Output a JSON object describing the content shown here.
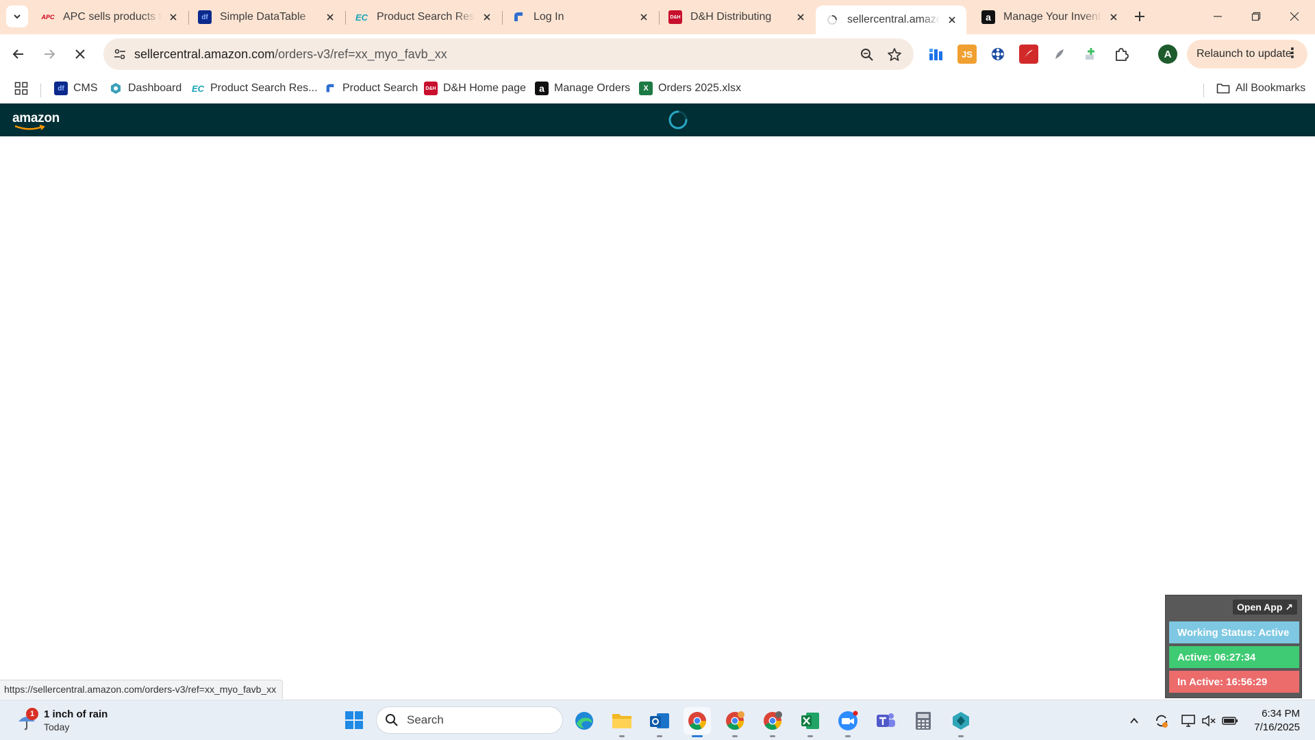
{
  "browser": {
    "tabs": [
      {
        "title": "APC sells products th",
        "favicon_text": "APC",
        "active": false
      },
      {
        "title": "Simple DataTable",
        "favicon_text": "df",
        "active": false
      },
      {
        "title": "Product Search Resul",
        "favicon_text": "EC",
        "active": false
      },
      {
        "title": "Log In",
        "favicon_text": "",
        "active": false
      },
      {
        "title": "D&H Distributing",
        "favicon_text": "D&H",
        "active": false
      },
      {
        "title": "sellercentral.amazon.",
        "favicon_text": "",
        "active": true
      },
      {
        "title": "Manage Your Invento",
        "favicon_text": "a",
        "active": false
      }
    ],
    "url_host": "sellercentral.amazon.com",
    "url_path": "/orders-v3/ref=xx_myo_favb_xx",
    "relaunch_label": "Relaunch to update",
    "profile_initial": "A",
    "bookmarks": [
      {
        "label": "CMS",
        "icon_text": "df"
      },
      {
        "label": "Dashboard",
        "icon_text": ""
      },
      {
        "label": "Product Search Res...",
        "icon_text": "EC"
      },
      {
        "label": "Product Search",
        "icon_text": ""
      },
      {
        "label": "D&H Home page",
        "icon_text": "D&H"
      },
      {
        "label": "Manage Orders",
        "icon_text": "a"
      },
      {
        "label": "Orders 2025.xlsx",
        "icon_text": "X"
      }
    ],
    "all_bookmarks_label": "All Bookmarks",
    "status_url": "https://sellercentral.amazon.com/orders-v3/ref=xx_myo_favb_xx"
  },
  "page": {
    "logo_text": "amazon",
    "loading": true
  },
  "widget": {
    "open_app_label": "Open App ↗",
    "working_status": "Working Status: Active",
    "active_time": "Active: 06:27:34",
    "inactive_time": "In Active: 16:56:29"
  },
  "taskbar": {
    "weather_badge": "1",
    "weather_line1": "1 inch of rain",
    "weather_line2": "Today",
    "search_placeholder": "Search",
    "time": "6:34 PM",
    "date": "7/16/2025"
  },
  "colors": {
    "tabstrip": "#fde4d2",
    "amazon_header": "#002f36",
    "widget_status": "#7ec8e3",
    "widget_active": "#3fcb73",
    "widget_inactive": "#ec6c6c"
  }
}
